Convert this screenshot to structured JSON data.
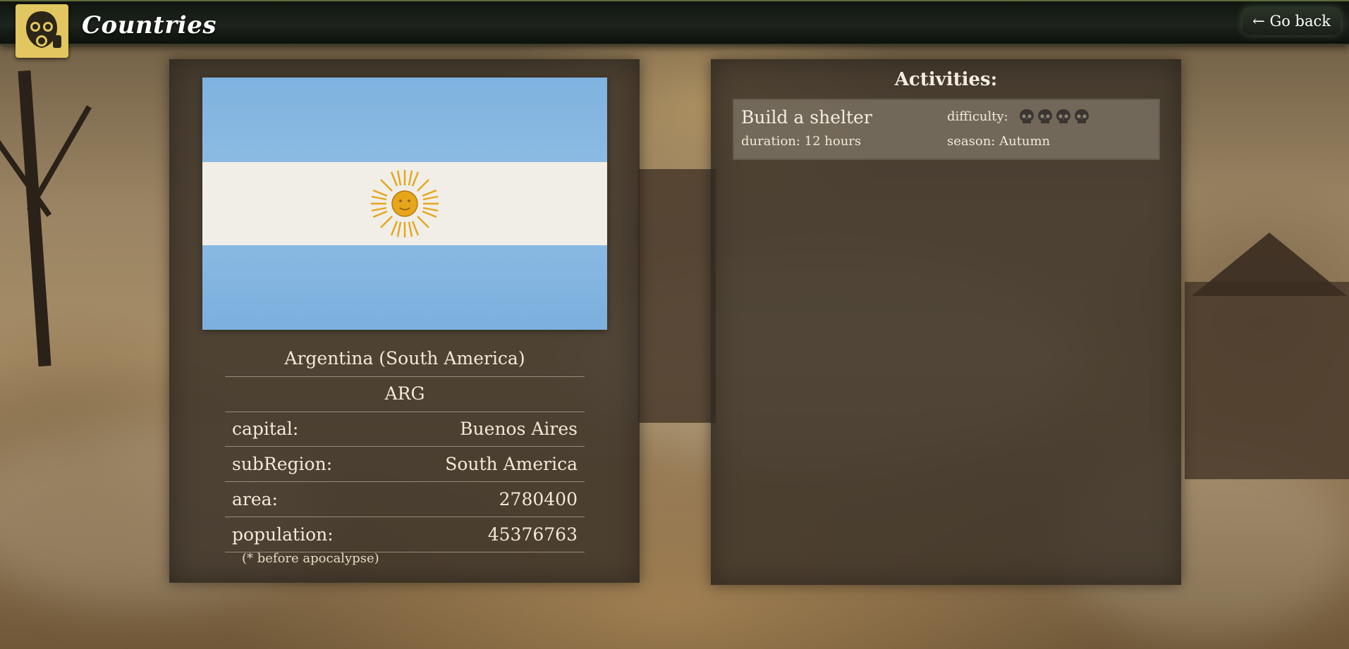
{
  "header": {
    "logo_icon": "gas-mask-icon",
    "title": "Countries",
    "go_back_label": "← Go back"
  },
  "country": {
    "flag_icon": "argentina-flag",
    "name": "Argentina (South America)",
    "code": "ARG",
    "fields": [
      {
        "label": "capital:",
        "value": "Buenos Aires"
      },
      {
        "label": "subRegion:",
        "value": "South America"
      },
      {
        "label": "area:",
        "value": "2780400"
      },
      {
        "label": "population:",
        "value": "45376763"
      }
    ],
    "footnote": "(* before apocalypse)"
  },
  "activities": {
    "title": "Activities:",
    "items": [
      {
        "name": "Build a shelter",
        "duration": "duration: 12 hours",
        "difficulty_label": "difficulty:",
        "difficulty_level": 4,
        "difficulty_icon": "skull-icon",
        "season": "season: Autumn"
      }
    ]
  },
  "colors": {
    "header_bg": "#141a13",
    "logo_bg": "#e2c65f",
    "panel_bg": "#3a3228",
    "flag_blue": "#7fb2df",
    "flag_white": "#f1eee7",
    "flag_sun": "#e6a51a"
  }
}
